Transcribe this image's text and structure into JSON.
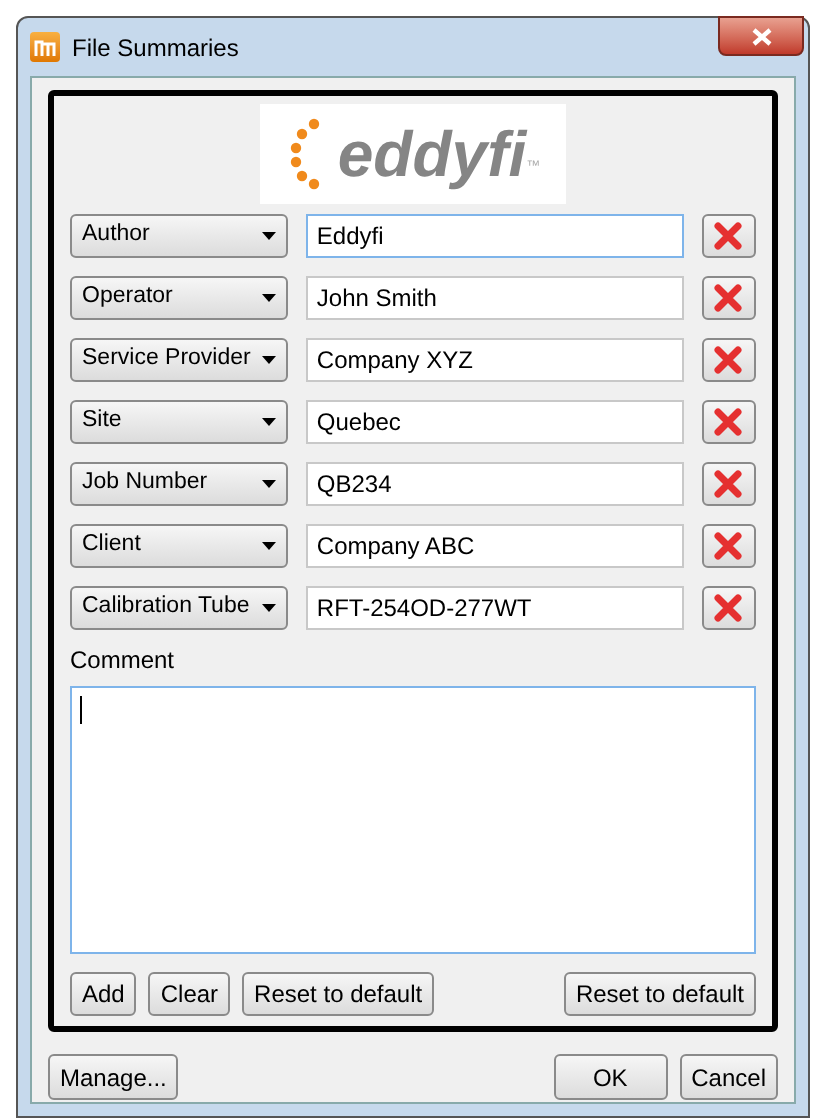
{
  "window": {
    "title": "File Summaries"
  },
  "logo": {
    "text": "eddyfi",
    "mark": "™"
  },
  "fields": [
    {
      "label": "Author",
      "value": "Eddyfi",
      "focused": true
    },
    {
      "label": "Operator",
      "value": "John Smith",
      "focused": false
    },
    {
      "label": "Service Provider",
      "value": "Company XYZ",
      "focused": false
    },
    {
      "label": "Site",
      "value": "Quebec",
      "focused": false
    },
    {
      "label": "Job Number",
      "value": "QB234",
      "focused": false
    },
    {
      "label": "Client",
      "value": "Company ABC",
      "focused": false
    },
    {
      "label": "Calibration Tube",
      "value": "RFT-254OD-277WT",
      "focused": false
    }
  ],
  "comment": {
    "label": "Comment"
  },
  "panel_buttons": [
    "Add",
    "Clear",
    "Reset to default"
  ],
  "panel_right_button": "Reset to default",
  "footer": {
    "left": "Manage...",
    "ok": "OK",
    "cancel": "Cancel"
  }
}
